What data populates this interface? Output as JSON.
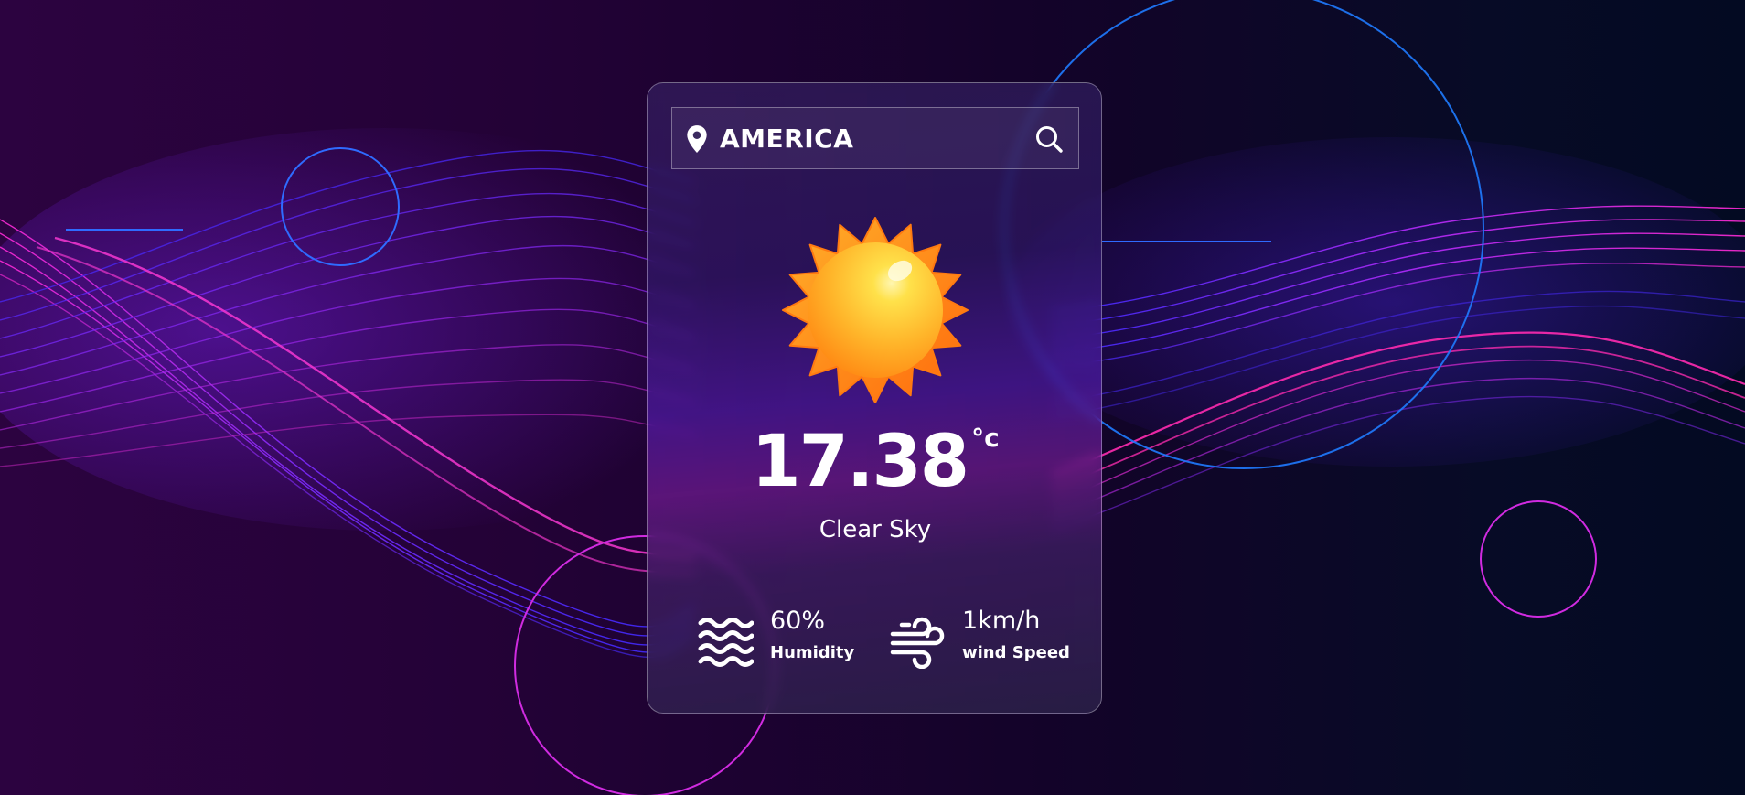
{
  "search": {
    "location_value": "AMERICA",
    "location_icon": "map-pin-icon",
    "search_icon": "magnifier-icon"
  },
  "weather": {
    "icon": "sun-icon",
    "temperature": "17.38",
    "unit": "°c",
    "condition": "Clear Sky"
  },
  "details": {
    "humidity": {
      "value": "60%",
      "label": "Humidity",
      "icon": "waves-icon"
    },
    "wind": {
      "value": "1km/h",
      "label": "wind Speed",
      "icon": "wind-icon"
    }
  },
  "colors": {
    "accent_magenta": "#ff2bd6",
    "accent_blue": "#2f6bff",
    "sun_orange": "#ff8a1c",
    "sun_yellow": "#ffd23c"
  }
}
